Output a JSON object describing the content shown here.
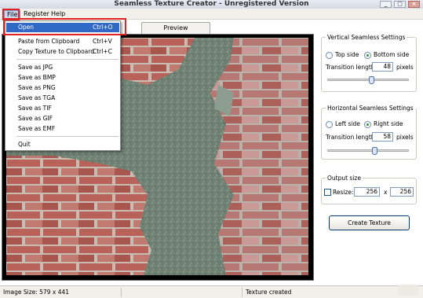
{
  "window": {
    "title": "Seamless Texture Creator - Unregistered Version",
    "minimize_glyph": "_",
    "maximize_glyph": "□",
    "close_glyph": "×"
  },
  "menubar": {
    "file": "File",
    "register": "Register",
    "help": "Help"
  },
  "tabs": {
    "preview": "Preview"
  },
  "file_menu": {
    "open": {
      "label": "Open",
      "shortcut": "Ctrl+O"
    },
    "paste": {
      "label": "Paste from Clipboard",
      "shortcut": "Ctrl+V"
    },
    "copy": {
      "label": "Copy Texture to Clipboard",
      "shortcut": "Ctrl+C"
    },
    "save_jpg": "Save as JPG",
    "save_bmp": "Save as BMP",
    "save_png": "Save as PNG",
    "save_tga": "Save as TGA",
    "save_tif": "Save as TIF",
    "save_gif": "Save as GIF",
    "save_emf": "Save as EMF",
    "quit": "Quit"
  },
  "vertical": {
    "title": "Vertical Seamless Settings",
    "top_side": "Top side",
    "bottom_side": "Bottom side",
    "selected": "bottom",
    "transition_label": "Transition length:",
    "transition_value": "48",
    "unit": "pixels",
    "slider_fraction": 0.48
  },
  "horizontal": {
    "title": "Horizontal Seamless Settings",
    "left_side": "Left side",
    "right_side": "Right side",
    "selected": "right",
    "transition_label": "Transition length:",
    "transition_value": "58",
    "unit": "pixels",
    "slider_fraction": 0.58
  },
  "output": {
    "title": "Output size",
    "resize_label": "Resize:",
    "resize_checked": false,
    "width": "256",
    "times": "x",
    "height": "256"
  },
  "create_button": "Create Texture",
  "status": {
    "image_size": "Image Size: 579 x 441",
    "message": "Texture created"
  }
}
